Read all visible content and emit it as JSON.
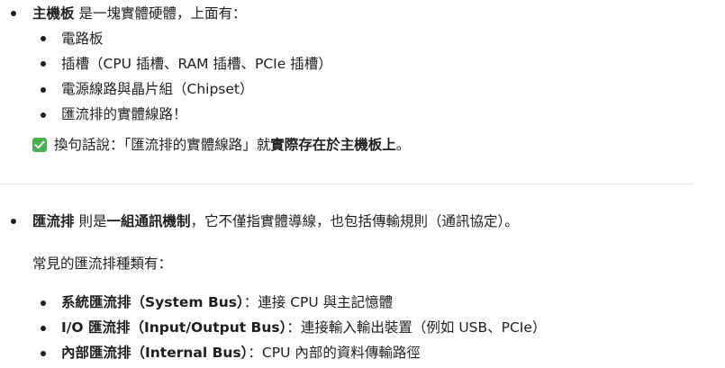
{
  "section1": {
    "lead": {
      "term": "主機板",
      "text": " 是一塊實體硬體，上面有："
    },
    "items": [
      "電路板",
      "插槽（CPU 插槽、RAM 插槽、PCIe 插槽）",
      "電源線路與晶片組（Chipset）",
      "匯流排的實體線路！"
    ],
    "note": {
      "icon": "check-mark-icon",
      "prefix": "換句話說：「匯流排的實體線路」就",
      "strong": "實際存在於主機板上",
      "suffix": "。"
    }
  },
  "section2": {
    "lead": {
      "term": "匯流排",
      "middle": " 則是",
      "strong": "一組通訊機制",
      "rest": "，它不僅指實體導線，也包括傳輸規則（通訊協定）。"
    },
    "intro": "常見的匯流排種類有：",
    "items": [
      {
        "term": "系統匯流排（System Bus）",
        "desc": "：連接 CPU 與主記憶體"
      },
      {
        "term": "I/O 匯流排（Input/Output Bus）",
        "desc": "：連接輸入輸出裝置（例如 USB、PCIe）"
      },
      {
        "term": "內部匯流排（Internal Bus）",
        "desc": "：CPU 內部的資料傳輸路徑"
      }
    ]
  },
  "colors": {
    "text": "#1f1f1f",
    "divider": "#e3e3e3",
    "check_bg": "#4caf50"
  }
}
